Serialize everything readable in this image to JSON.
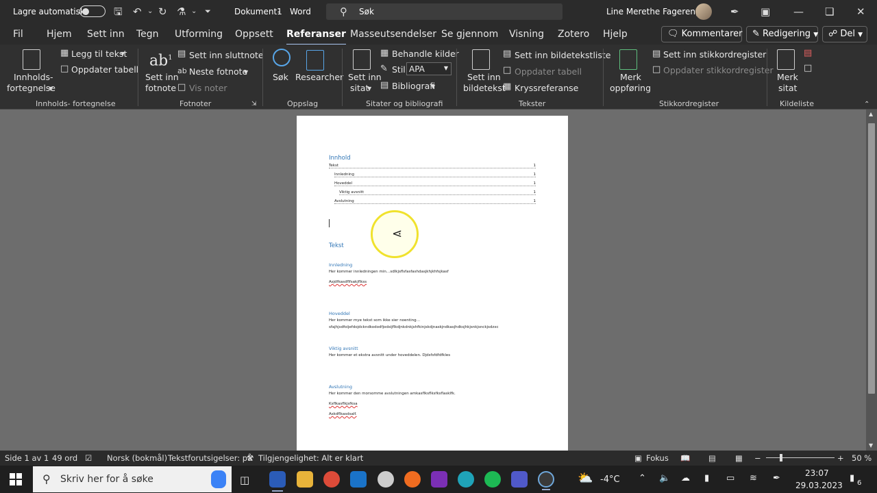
{
  "titlebar": {
    "autosave_label": "Lagre automatisk",
    "doc_title": "Dokument1",
    "app_name": "Word",
    "search_placeholder": "Søk",
    "user_name": "Line Merethe Fagereng"
  },
  "tabs": [
    "Fil",
    "Hjem",
    "Sett inn",
    "Tegn",
    "Utforming",
    "Oppsett",
    "Referanser",
    "Masseutsendelser",
    "Se gjennom",
    "Visning",
    "Zotero",
    "Hjelp"
  ],
  "active_tab": "Referanser",
  "header_buttons": {
    "comments": "Kommentarer",
    "editing": "Redigering",
    "share": "Del"
  },
  "ribbon": {
    "toc": {
      "btn1": "Innholds-",
      "btn2": "fortegnelse",
      "add_text": "Legg til tekst",
      "update_table": "Oppdater tabell",
      "group": "Innholds- fortegnelse"
    },
    "footnotes": {
      "insert1": "Sett inn",
      "insert2": "fotnote",
      "endnote": "Sett inn sluttnote",
      "next": "Neste fotnote",
      "show": "Vis noter",
      "group": "Fotnoter"
    },
    "research": {
      "search": "Søk",
      "researcher": "Researcher",
      "group": "Oppslag"
    },
    "citations": {
      "insert1": "Sett inn",
      "insert2": "sitat",
      "manage": "Behandle kilder",
      "style_label": "Stil:",
      "style_value": "APA",
      "bibliography": "Bibliografi",
      "group": "Sitater og bibliografi"
    },
    "captions": {
      "insert1": "Sett inn",
      "insert2": "bildetekst",
      "table_of_figures": "Sett inn bildetekstliste",
      "update": "Oppdater tabell",
      "cross_ref": "Kryssreferanse",
      "group": "Tekster"
    },
    "index": {
      "mark1": "Merk",
      "mark2": "oppføring",
      "insert": "Sett inn stikkordregister",
      "update": "Oppdater stikkordregister",
      "group": "Stikkordregister"
    },
    "authorities": {
      "mark1": "Merk",
      "mark2": "sitat",
      "group": "Kildeliste"
    }
  },
  "document": {
    "toc_heading": "Innhold",
    "toc_entries": [
      {
        "label": "Tekst",
        "page": "1"
      },
      {
        "label": "Innledning",
        "page": "1"
      },
      {
        "label": "Hoveddel",
        "page": "1"
      },
      {
        "label": "Viktig avsnitt",
        "page": "1"
      },
      {
        "label": "Avslutning",
        "page": "1"
      }
    ],
    "h1": "Tekst",
    "sections": [
      {
        "heading": "Innledning",
        "lines": [
          "Her kommer innledningen min…sdlkjsflsfasfashdasjkhjkhfsjkasf",
          "Asjdfkasdflfsakjflkss"
        ]
      },
      {
        "heading": "Hoveddel",
        "lines": [
          "Her kommer mye tekst som ikke sier noenting…",
          "sfajhjsdfoijefdojdckndkododfjodsijflkdjnkdnkjshfkinjskdjnaskjndkasjhdksjhkjsnkjsnckjsdzxc"
        ]
      },
      {
        "heading": "Viktig avsnitt",
        "lines": [
          "Her kommer et ekstra avsnitt under hoveddelen. Djdsfsfdfdfkles"
        ]
      },
      {
        "heading": "Avslutning",
        "lines": [
          "Her kommer den morsomme avslutningen amkasflksflksfksflasklfk.",
          "Ksflkasflkjsfksa",
          "Askdflkasdsalf."
        ]
      }
    ]
  },
  "statusbar": {
    "page": "Side 1 av 1",
    "words": "49 ord",
    "language": "Norsk (bokmål)",
    "predictions": "Tekstforutsigelser: på",
    "accessibility": "Tilgjengelighet: Alt er klart",
    "focus": "Fokus",
    "zoom": "50 %"
  },
  "taskbar": {
    "search_placeholder": "Skriv her for å søke",
    "weather": "-4°C",
    "time": "23:07",
    "date": "29.03.2023",
    "notifications": "6"
  }
}
